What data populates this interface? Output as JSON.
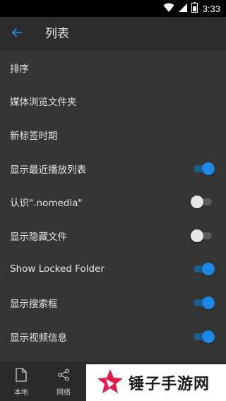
{
  "status_bar": {
    "time": "3:33",
    "icons": [
      "wifi-icon",
      "signal-icon",
      "battery-icon"
    ]
  },
  "app_bar": {
    "back_icon": "arrow-left-icon",
    "title": "列表"
  },
  "colors": {
    "accent": "#1e88e5",
    "background": "#353535",
    "app_bar": "#2c2c2c"
  },
  "settings": [
    {
      "label": "排序",
      "toggle": null
    },
    {
      "label": "媒体浏览文件夹",
      "toggle": null
    },
    {
      "label": "新标签时期",
      "toggle": null
    },
    {
      "label": "显示最近播放列表",
      "toggle": true
    },
    {
      "label": "认识\".nomedia\"",
      "toggle": false
    },
    {
      "label": "显示隐藏文件",
      "toggle": false
    },
    {
      "label": "Show Locked Folder",
      "toggle": true
    },
    {
      "label": "显示搜索框",
      "toggle": true
    },
    {
      "label": "显示视频信息",
      "toggle": true
    }
  ],
  "bottom_nav": [
    {
      "label": "本地",
      "icon": "file-icon"
    },
    {
      "label": "网络",
      "icon": "share-icon"
    }
  ],
  "watermark": {
    "text": "锤子手游网",
    "logo_icon": "star-logo-icon"
  }
}
